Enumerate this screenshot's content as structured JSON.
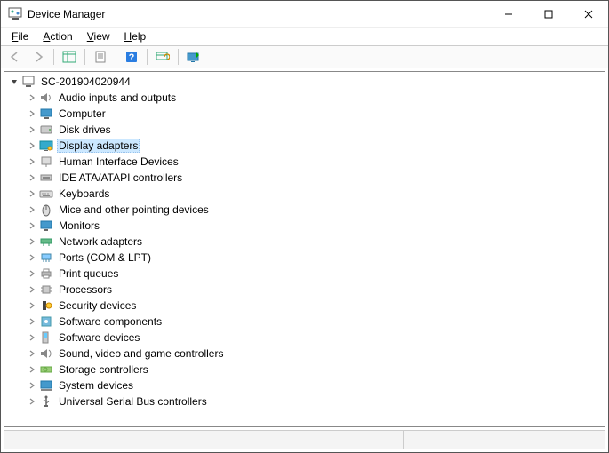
{
  "window": {
    "title": "Device Manager"
  },
  "menu": {
    "file": "File",
    "action": "Action",
    "view": "View",
    "help": "Help"
  },
  "tree": {
    "root": "SC-201904020944",
    "items": [
      {
        "label": "Audio inputs and outputs",
        "icon": "speaker"
      },
      {
        "label": "Computer",
        "icon": "computer"
      },
      {
        "label": "Disk drives",
        "icon": "disk"
      },
      {
        "label": "Display adapters",
        "icon": "display",
        "selected": true
      },
      {
        "label": "Human Interface Devices",
        "icon": "hid"
      },
      {
        "label": "IDE ATA/ATAPI controllers",
        "icon": "ide"
      },
      {
        "label": "Keyboards",
        "icon": "keyboard"
      },
      {
        "label": "Mice and other pointing devices",
        "icon": "mouse"
      },
      {
        "label": "Monitors",
        "icon": "monitor"
      },
      {
        "label": "Network adapters",
        "icon": "network"
      },
      {
        "label": "Ports (COM & LPT)",
        "icon": "port"
      },
      {
        "label": "Print queues",
        "icon": "printer"
      },
      {
        "label": "Processors",
        "icon": "cpu"
      },
      {
        "label": "Security devices",
        "icon": "security"
      },
      {
        "label": "Software components",
        "icon": "swcomp"
      },
      {
        "label": "Software devices",
        "icon": "swdev"
      },
      {
        "label": "Sound, video and game controllers",
        "icon": "sound"
      },
      {
        "label": "Storage controllers",
        "icon": "storage"
      },
      {
        "label": "System devices",
        "icon": "system"
      },
      {
        "label": "Universal Serial Bus controllers",
        "icon": "usb"
      }
    ]
  }
}
